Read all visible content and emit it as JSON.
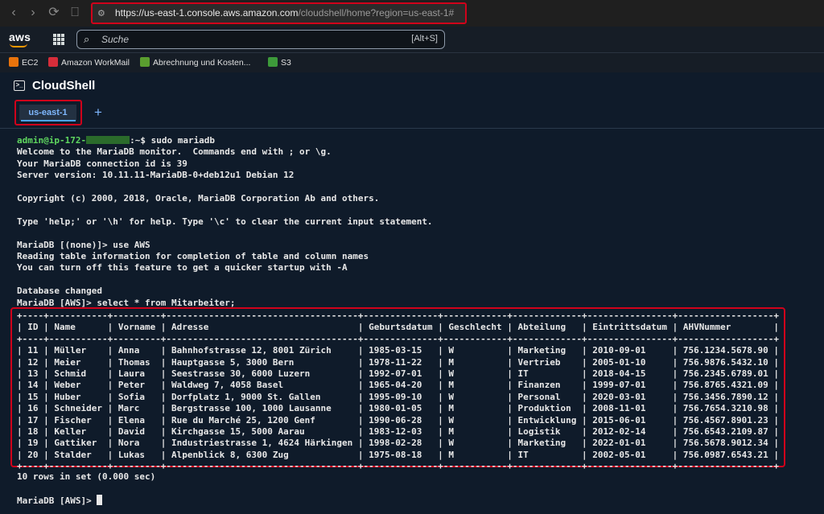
{
  "browser": {
    "url_host": "https://us-east-1.console.aws.amazon.com",
    "url_path": "/cloudshell/home?region=us-east-1#"
  },
  "aws_nav": {
    "logo": "aws",
    "search_placeholder": "Suche",
    "search_shortcut": "[Alt+S]"
  },
  "bookmarks": [
    {
      "label": "EC2",
      "icon": "ec2-icon",
      "color": "#e8730c"
    },
    {
      "label": "Amazon WorkMail",
      "icon": "workmail-icon",
      "color": "#d62d3a"
    },
    {
      "label": "Abrechnung und Kosten...",
      "icon": "billing-icon",
      "color": "#5a9e2f"
    },
    {
      "label": "S3",
      "icon": "s3-icon",
      "color": "#3d9a3a"
    }
  ],
  "cloudshell": {
    "title": "CloudShell",
    "tab_label": "us-east-1",
    "add_tab": "+"
  },
  "terminal": {
    "prompt_user": "admin@ip-172-",
    "prompt_suffix": ":~$ sudo mariadb",
    "lines": [
      "Welcome to the MariaDB monitor.  Commands end with ; or \\g.",
      "Your MariaDB connection id is 39",
      "Server version: 10.11.11-MariaDB-0+deb12u1 Debian 12",
      "",
      "Copyright (c) 2000, 2018, Oracle, MariaDB Corporation Ab and others.",
      "",
      "Type 'help;' or '\\h' for help. Type '\\c' to clear the current input statement.",
      "",
      "MariaDB [(none)]> use AWS",
      "Reading table information for completion of table and column names",
      "You can turn off this feature to get a quicker startup with -A",
      "",
      "Database changed",
      "MariaDB [AWS]> select * from Mitarbeiter;"
    ],
    "table_columns": [
      "ID",
      "Name",
      "Vorname",
      "Adresse",
      "Geburtsdatum",
      "Geschlecht",
      "Abteilung",
      "Eintrittsdatum",
      "AHVNummer"
    ],
    "table_rows": [
      [
        "11",
        "Müller",
        "Anna",
        "Bahnhofstrasse 12, 8001 Zürich",
        "1985-03-15",
        "W",
        "Marketing",
        "2010-09-01",
        "756.1234.5678.90"
      ],
      [
        "12",
        "Meier",
        "Thomas",
        "Hauptgasse 5, 3000 Bern",
        "1978-11-22",
        "M",
        "Vertrieb",
        "2005-01-10",
        "756.9876.5432.10"
      ],
      [
        "13",
        "Schmid",
        "Laura",
        "Seestrasse 30, 6000 Luzern",
        "1992-07-01",
        "W",
        "IT",
        "2018-04-15",
        "756.2345.6789.01"
      ],
      [
        "14",
        "Weber",
        "Peter",
        "Waldweg 7, 4058 Basel",
        "1965-04-20",
        "M",
        "Finanzen",
        "1999-07-01",
        "756.8765.4321.09"
      ],
      [
        "15",
        "Huber",
        "Sofia",
        "Dorfplatz 1, 9000 St. Gallen",
        "1995-09-10",
        "W",
        "Personal",
        "2020-03-01",
        "756.3456.7890.12"
      ],
      [
        "16",
        "Schneider",
        "Marc",
        "Bergstrasse 100, 1000 Lausanne",
        "1980-01-05",
        "M",
        "Produktion",
        "2008-11-01",
        "756.7654.3210.98"
      ],
      [
        "17",
        "Fischer",
        "Elena",
        "Rue du Marché 25, 1200 Genf",
        "1990-06-28",
        "W",
        "Entwicklung",
        "2015-06-01",
        "756.4567.8901.23"
      ],
      [
        "18",
        "Keller",
        "David",
        "Kirchgasse 15, 5000 Aarau",
        "1983-12-03",
        "M",
        "Logistik",
        "2012-02-14",
        "756.6543.2109.87"
      ],
      [
        "19",
        "Gattiker",
        "Nora",
        "Industriestrasse 1, 4624 Härkingen",
        "1998-02-28",
        "W",
        "Marketing",
        "2022-01-01",
        "756.5678.9012.34"
      ],
      [
        "20",
        "Stalder",
        "Lukas",
        "Alpenblick 8, 6300 Zug",
        "1975-08-18",
        "M",
        "IT",
        "2002-05-01",
        "756.0987.6543.21"
      ]
    ],
    "rows_summary": "10 rows in set (0.000 sec)",
    "final_prompt": "MariaDB [AWS]> "
  }
}
